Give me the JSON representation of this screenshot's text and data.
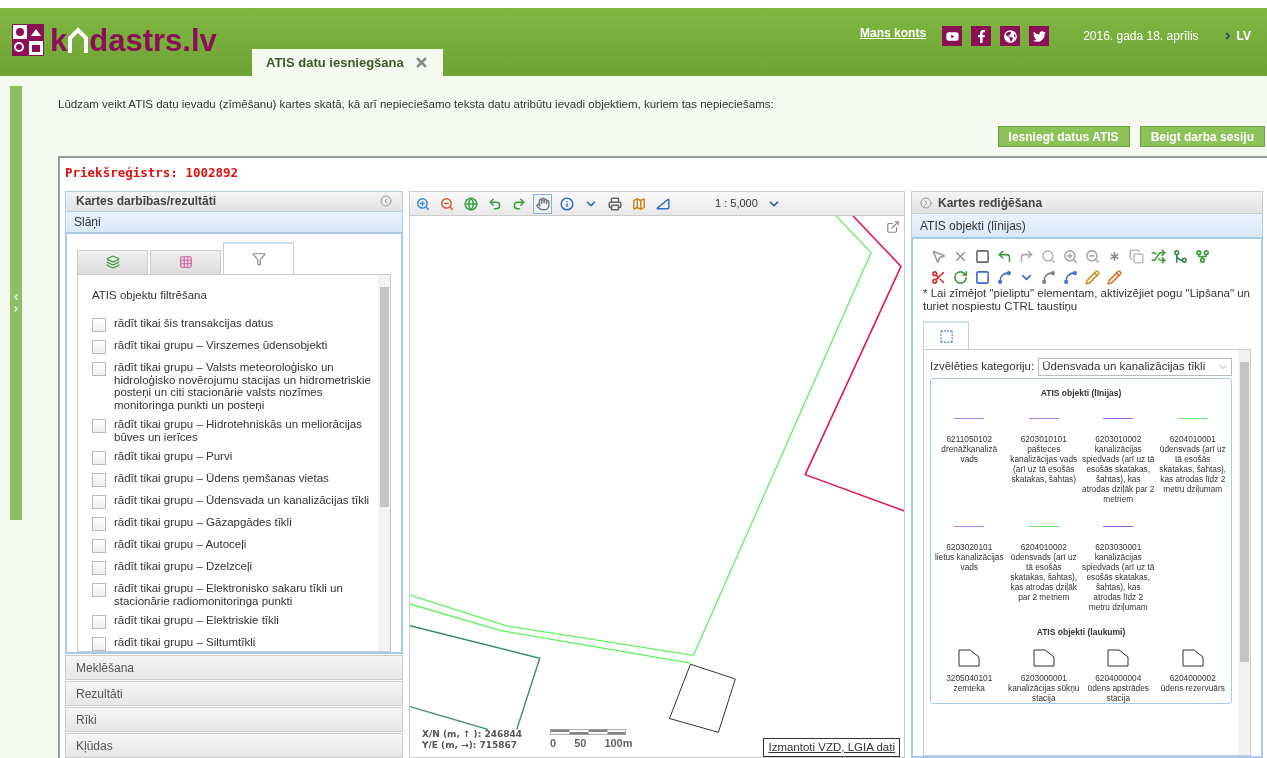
{
  "header": {
    "logo_prefix": "k",
    "logo_suffix": "dastrs.lv",
    "account_link": "Mans konts",
    "date": "2016. gada 18. aprīlis",
    "language": "LV"
  },
  "tabs": [
    {
      "label": "ATIS datu iesniegšana",
      "selected": true
    }
  ],
  "intro": "Lūdzam veikt ATIS datu ievadu (zīmēšanu) kartes skatā, kā arī nepieciešamo teksta datu atribūtu ievadi objektiem, kuriem tas nepieciešams:",
  "buttons": [
    "Iesniegt datus ATIS",
    "Beigt darba sesiju"
  ],
  "register": "Priekšreģistrs: 1002892",
  "left_panel": {
    "title": "Kartes darbības/rezultāti",
    "section": "Slāņi",
    "tabs": [
      {
        "kind": "layers",
        "selected": false
      },
      {
        "kind": "legend",
        "selected": false
      },
      {
        "kind": "filter",
        "selected": true
      }
    ],
    "filter_title": "ATIS objektu filtrēšana",
    "filters": [
      {
        "label": "rādīt tikai šis transakcijas datus",
        "checked": false
      },
      {
        "label": "rādīt tikai grupu – Virszemes ūdensobjekti",
        "checked": false
      },
      {
        "label": "rādīt tikai grupu – Valsts meteoroloģisko un hidroloģisko novērojumu stacijas un hidrometriskie posteņi un citi stacionārie valsts nozīmes monitoringa punkti un posteņi",
        "checked": false
      },
      {
        "label": "rādīt tikai grupu – Hidrotehniskās un meliorācijas būves un ierīces",
        "checked": false
      },
      {
        "label": "rādīt tikai grupu – Purvi",
        "checked": false
      },
      {
        "label": "rādīt tikai grupu – Ūdens ņemšanas vietas",
        "checked": false
      },
      {
        "label": "rādīt tikai grupu – Ūdensvada un kanalizācijas tīkli",
        "checked": false
      },
      {
        "label": "rādīt tikai grupu – Gāzapgādes tīkli",
        "checked": false
      },
      {
        "label": "rādīt tikai grupu – Autoceļi",
        "checked": false
      },
      {
        "label": "rādīt tikai grupu – Dzelzceļi",
        "checked": false
      },
      {
        "label": "rādīt tikai grupu – Elektronisko sakaru tīkli un stacionārie radiomonitoringa punkti",
        "checked": false
      },
      {
        "label": "rādīt tikai grupu – Elektriskie tīkli",
        "checked": false
      },
      {
        "label": "rādīt tikai grupu – Siltumtīkli",
        "checked": false
      }
    ],
    "accordion": [
      "Meklēšana",
      "Rezultāti",
      "Rīki",
      "Kļūdas"
    ]
  },
  "map": {
    "tools": [
      {
        "kind": "zoom_in",
        "selected": false
      },
      {
        "kind": "zoom_out",
        "selected": false
      },
      {
        "kind": "globe",
        "selected": false
      },
      {
        "kind": "undo",
        "selected": false
      },
      {
        "kind": "redo",
        "selected": false
      },
      {
        "kind": "pan",
        "selected": true
      },
      {
        "kind": "info",
        "selected": false
      },
      {
        "kind": "dropdown",
        "selected": false
      },
      {
        "kind": "print",
        "selected": false
      },
      {
        "kind": "map",
        "selected": false
      },
      {
        "kind": "measure",
        "selected": false
      }
    ],
    "scale": "1 : 5,000",
    "x_label": "X/N (m, ↑ ):",
    "x_value": "246844",
    "y_label": "Y/E (m, →):",
    "y_value": "715867",
    "scale_labels": [
      "0",
      "50",
      "100m"
    ],
    "attribution": "Izmantoti VZD, LGIA dati"
  },
  "right_panel": {
    "title": "Kartes rediģēšana",
    "section": "ATIS objekti (līnijas)",
    "hint": "* Lai zīmējot \"pieliptu\" elementam, aktivizējiet pogu \"Lipšana\" un turiet nospiestu CTRL taustiņu",
    "category_label": "Izvēlēties kategoriju:",
    "category_value": "Ūdensvada un kanalizācijas tīkli",
    "lines_title": "ATIS objekti (līnijas)",
    "line_objects": [
      {
        "code": "6211050102",
        "name": "drenāžkanalizā vads",
        "color": "#b57be6"
      },
      {
        "code": "6203010101",
        "name": "pašteces kanalizācijas vads (arī uz tā esošās skatakas, šahtas)",
        "color": "#b57be6"
      },
      {
        "code": "6203010002",
        "name": "kanalizācijas spiedvads (arī uz tā esošās skatakas, šahtas), kas atrodas dziļāk par 2 metriem",
        "color": "#9b59d6"
      },
      {
        "code": "6204010001",
        "name": "ūdensvads (arī uz tā esošās skatakas, šahtas), kas atrodas līdz 2 metru dziļumam",
        "color": "#6fe86f"
      },
      {
        "code": "6203020101",
        "name": "lietus kanalizācijas vads",
        "color": "#b57be6"
      },
      {
        "code": "6204010002",
        "name": "ūdensvads (arī uz tā esošās skatakas, šahtas), kas atrodas dziļāk par 2 metriem",
        "color": "#6fe86f"
      },
      {
        "code": "6203030001",
        "name": "kanalizācijas spiedvads (arī uz tā esošās skatakas, šahtas), kas atrodas līdz 2 metru dziļumam",
        "color": "#9b59d6"
      }
    ],
    "areas_title": "ATIS objekti (laukumi)",
    "area_objects": [
      {
        "code": "3205040101",
        "name": "zemteka"
      },
      {
        "code": "6203000001",
        "name": "kanalizācijas sūkņu stacija"
      },
      {
        "code": "6204000004",
        "name": "ūdens apstrādes stacija"
      },
      {
        "code": "6204000002",
        "name": "ūdens rezervuārs"
      }
    ]
  }
}
